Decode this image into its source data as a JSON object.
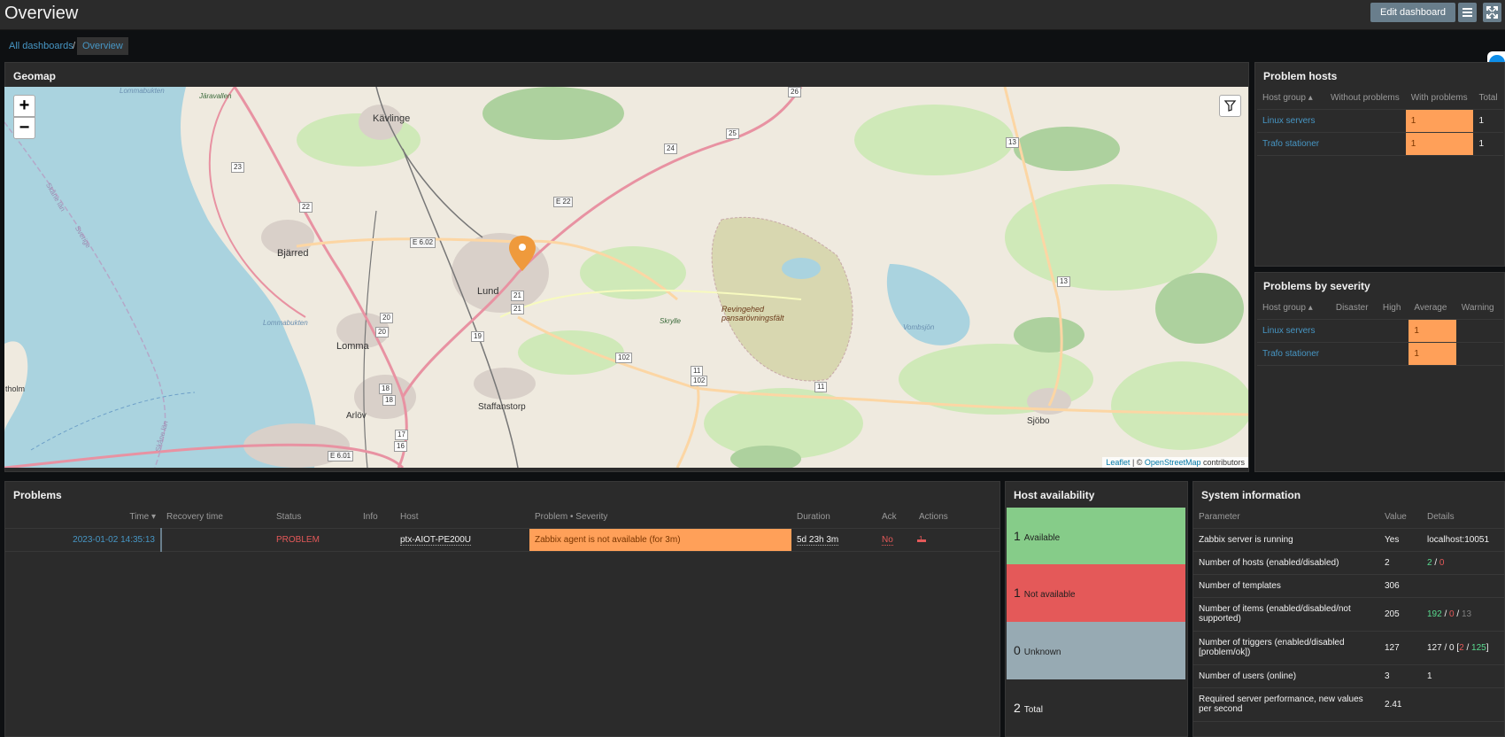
{
  "header": {
    "title": "Overview",
    "edit_label": "Edit dashboard"
  },
  "breadcrumb": {
    "root": "All dashboards",
    "separator": "/",
    "current": "Overview"
  },
  "geomap": {
    "title": "Geomap",
    "zoom_in": "+",
    "zoom_out": "−",
    "attribution": {
      "leaflet": "Leaflet",
      "sep": " | © ",
      "osm": "OpenStreetMap",
      "suffix": " contributors"
    },
    "places": [
      "Kävlinge",
      "Bjärred",
      "Lund",
      "Lomma",
      "Arlöv",
      "Staffanstorp",
      "Sjöbo",
      "Revingehed pansarövningsfält",
      "Lommabukten",
      "Vombsjön",
      "Skrylle",
      "Järavallen",
      "Lommabukten",
      "Skåne län",
      "Sverige",
      "Skåne län",
      "tholm"
    ],
    "roads": [
      "E 22",
      "E 6.02",
      "E 6.01",
      "23",
      "22",
      "24",
      "25",
      "26",
      "13",
      "13",
      "102",
      "11",
      "102",
      "11",
      "21",
      "19",
      "20",
      "20",
      "18",
      "18",
      "17",
      "16",
      "21"
    ]
  },
  "problem_hosts": {
    "title": "Problem hosts",
    "columns": [
      "Host group ▴",
      "Without problems",
      "With problems",
      "Total"
    ],
    "rows": [
      {
        "group": "Linux servers",
        "without": "",
        "with": "1",
        "total": "1"
      },
      {
        "group": "Trafo stationer",
        "without": "",
        "with": "1",
        "total": "1"
      }
    ]
  },
  "problems_by_severity": {
    "title": "Problems by severity",
    "columns": [
      "Host group ▴",
      "Disaster",
      "High",
      "Average",
      "Warning"
    ],
    "rows": [
      {
        "group": "Linux servers",
        "average": "1"
      },
      {
        "group": "Trafo stationer",
        "average": "1"
      }
    ]
  },
  "problems": {
    "title": "Problems",
    "columns": [
      "Time ▾",
      "Recovery time",
      "Status",
      "Info",
      "Host",
      "Problem • Severity",
      "Duration",
      "Ack",
      "Actions"
    ],
    "rows": [
      {
        "time": "2023-01-02 14:35:13",
        "recovery": "",
        "status": "PROBLEM",
        "info": "",
        "host": "ptx-AIOT-PE200U",
        "problem": "Zabbix agent is not available (for 3m)",
        "duration": "5d 23h 3m",
        "ack": "No",
        "actions": "1"
      }
    ]
  },
  "host_availability": {
    "title": "Host availability",
    "rows": [
      {
        "count": "1",
        "label": "Available",
        "color": "#86cc89"
      },
      {
        "count": "1",
        "label": "Not available",
        "color": "#e45959"
      },
      {
        "count": "0",
        "label": "Unknown",
        "color": "#97aab3"
      },
      {
        "count": "2",
        "label": "Total",
        "color": "#2b2b2b"
      }
    ]
  },
  "system_info": {
    "title": "System information",
    "columns": [
      "Parameter",
      "Value",
      "Details"
    ],
    "rows": [
      {
        "param": "Zabbix server is running",
        "value": "Yes",
        "details": "localhost:10051"
      },
      {
        "param": "Number of hosts (enabled/disabled)",
        "value": "2",
        "d1": "2",
        "d2": "0"
      },
      {
        "param": "Number of templates",
        "value": "306"
      },
      {
        "param": "Number of items (enabled/disabled/not supported)",
        "value": "205",
        "d1": "192",
        "d2": "0",
        "d3": "13"
      },
      {
        "param": "Number of triggers (enabled/disabled [problem/ok])",
        "value": "127",
        "d_prefix": "127 / 0 [",
        "d1": "2",
        "d2": "125",
        "d_suffix": "]"
      },
      {
        "param": "Number of users (online)",
        "value": "3",
        "d1": "1"
      },
      {
        "param": "Required server performance, new values per second",
        "value": "2.41"
      }
    ]
  },
  "colors": {
    "problem_orange": "#ffa059",
    "link": "#4796c4",
    "status_red": "#e45959",
    "ok_green": "#59db8f"
  }
}
